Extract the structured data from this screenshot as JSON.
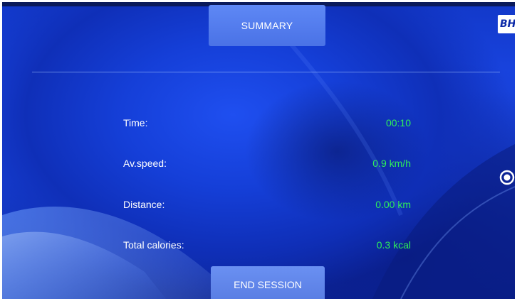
{
  "header": {
    "summary_label": "SUMMARY",
    "brand_logo_text": "BH"
  },
  "stats": [
    {
      "label": "Time:",
      "value": "00:10"
    },
    {
      "label": "Av.speed:",
      "value": "0.9 km/h"
    },
    {
      "label": "Distance:",
      "value": "0.00 km"
    },
    {
      "label": "Total calories:",
      "value": "0.3 kcal"
    }
  ],
  "footer": {
    "end_session_label": "END SESSION"
  },
  "side": {
    "indicator_icon": "radio-circle-icon"
  },
  "colors": {
    "background_blue": "#173fd3",
    "button_blue": "#5a82ee",
    "value_green": "#2ef05a",
    "label_white": "#ffffff"
  }
}
